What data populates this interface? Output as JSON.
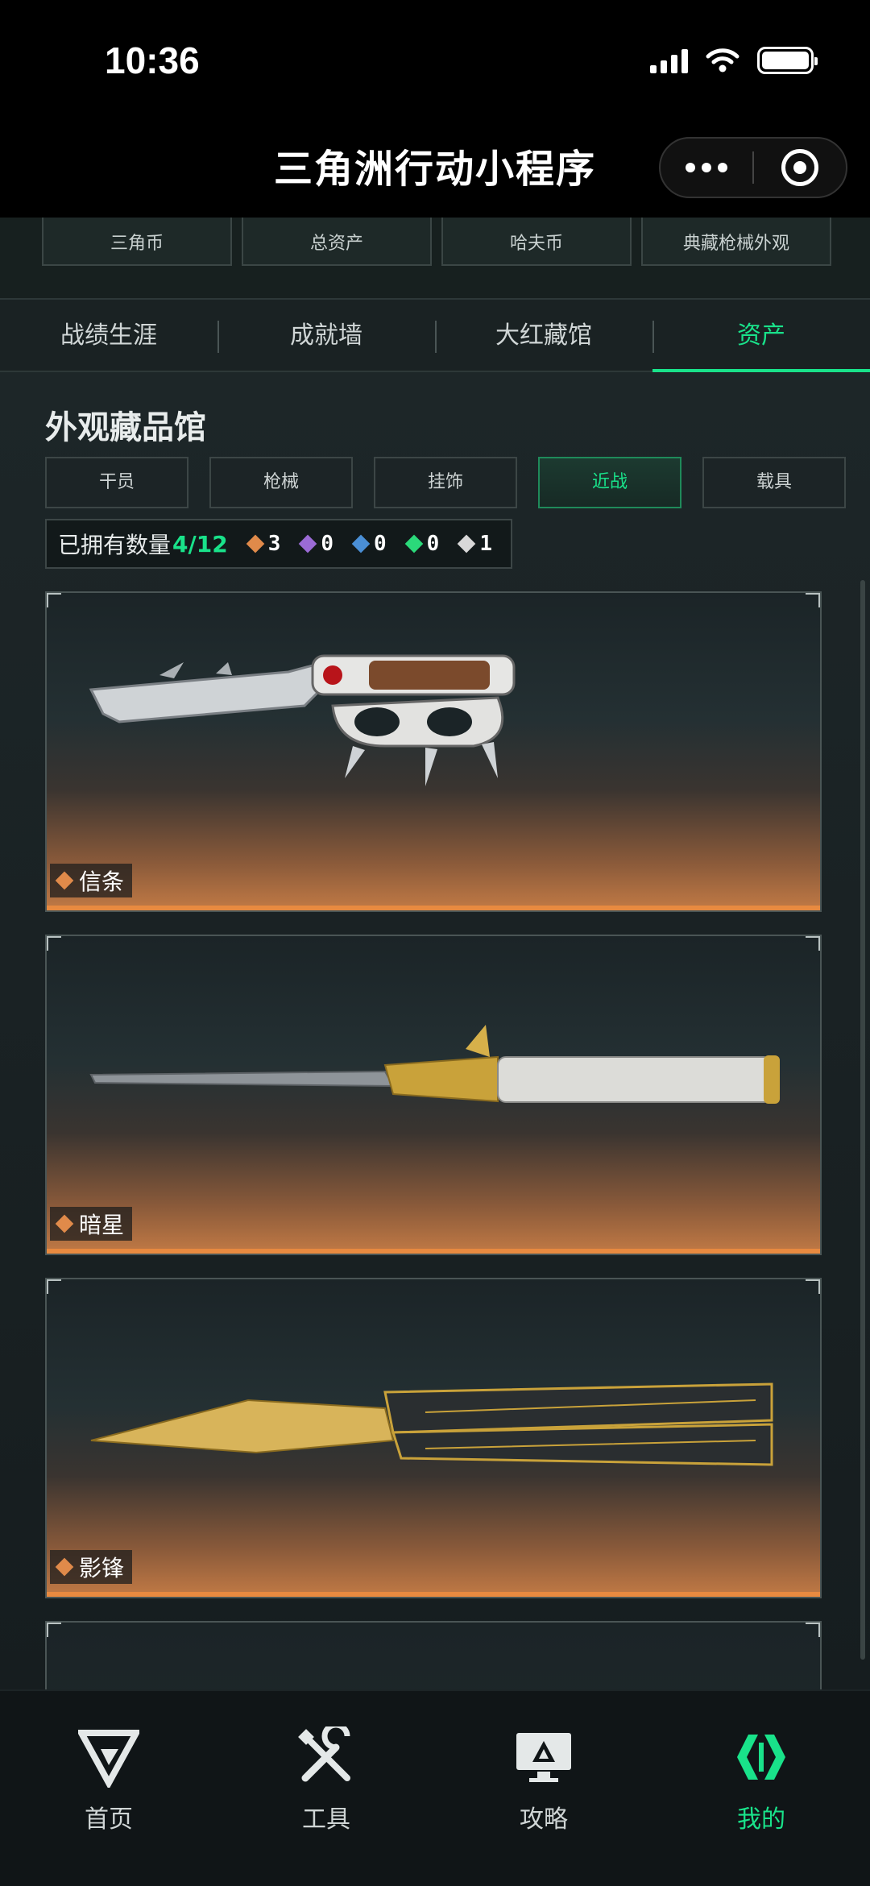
{
  "status_bar": {
    "time": "10:36"
  },
  "nav": {
    "title": "三角洲行动小程序"
  },
  "stats": [
    {
      "label": "三角币"
    },
    {
      "label": "总资产"
    },
    {
      "label": "哈夫币"
    },
    {
      "label": "典藏枪械外观"
    }
  ],
  "tabs": [
    {
      "label": "战绩生涯"
    },
    {
      "label": "成就墙"
    },
    {
      "label": "大红藏馆"
    },
    {
      "label": "资产"
    }
  ],
  "section": {
    "title": "外观藏品馆"
  },
  "filters": [
    {
      "label": "干员"
    },
    {
      "label": "枪械"
    },
    {
      "label": "挂饰"
    },
    {
      "label": "近战"
    },
    {
      "label": "载具"
    }
  ],
  "owned": {
    "label": "已拥有数量",
    "count": "4/12",
    "rarities": [
      {
        "value": "3",
        "color": "#e08a4a"
      },
      {
        "value": "0",
        "color": "#9b6bd6"
      },
      {
        "value": "0",
        "color": "#4a8fd6"
      },
      {
        "value": "0",
        "color": "#2bd97a"
      },
      {
        "value": "1",
        "color": "#d8d8d8"
      }
    ]
  },
  "items": [
    {
      "name": "信条"
    },
    {
      "name": "暗星"
    },
    {
      "name": "影锋"
    }
  ],
  "bottom_nav": [
    {
      "label": "首页"
    },
    {
      "label": "工具"
    },
    {
      "label": "攻略"
    },
    {
      "label": "我的"
    }
  ],
  "colors": {
    "accent": "#19e28a",
    "rarity_gold": "#e08a4a"
  }
}
